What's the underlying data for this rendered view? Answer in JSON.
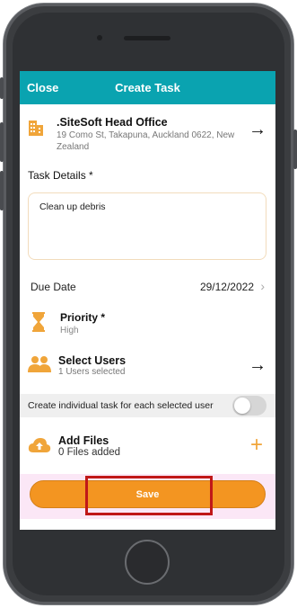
{
  "header": {
    "close_label": "Close",
    "title": "Create Task"
  },
  "site": {
    "name": ".SiteSoft Head Office",
    "address": "19 Como St, Takapuna, Auckland 0622, New Zealand",
    "icon": "building-icon"
  },
  "task_details": {
    "label": "Task Details *",
    "value": "Clean up debris"
  },
  "due_date": {
    "label": "Due Date",
    "value": "29/12/2022"
  },
  "priority": {
    "label": "Priority *",
    "value": "High",
    "icon": "hourglass-icon"
  },
  "select_users": {
    "label": "Select Users",
    "summary": "1 Users selected",
    "icon": "users-icon"
  },
  "individual_task": {
    "label": "Create individual task for each selected user",
    "enabled": false
  },
  "add_files": {
    "label": "Add Files",
    "summary": "0 Files added",
    "icon": "cloud-upload-icon"
  },
  "save": {
    "label": "Save"
  },
  "colors": {
    "header": "#0aa3b0",
    "accent": "#f39521",
    "highlight": "#c01818"
  }
}
